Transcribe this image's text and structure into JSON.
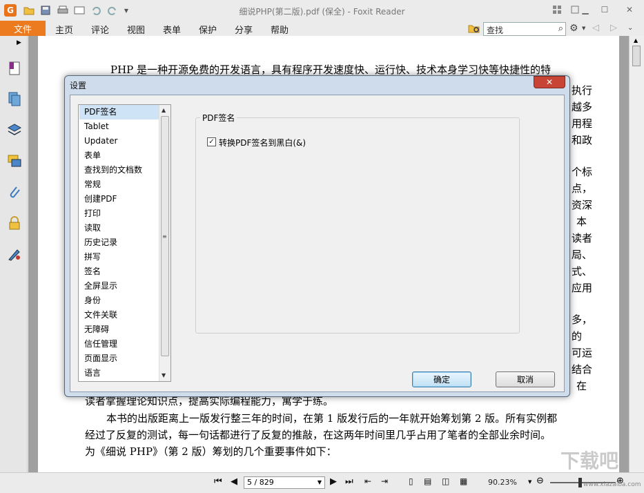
{
  "window": {
    "title": "细说PHP(第二版).pdf (保全) - Foxit Reader",
    "app_icon": "G"
  },
  "menu": {
    "file": "文件",
    "items": [
      "主页",
      "评论",
      "视图",
      "表单",
      "保护",
      "分享",
      "帮助"
    ]
  },
  "search": {
    "value": "查找"
  },
  "document": {
    "lines": [
      "PHP 是一种开源免费的开发语言，具有程序开发速度快、运行快、技术本身学习快等快捷性的特",
      "读者掌握理论知识点，提高实际编程能力，寓学于练。",
      "本书的出版距离上一版发行整三年的时间，在第 1 版发行后的一年就开始筹划第 2 版。所有实例都",
      "经过了反复的测试，每一句话都进行了反复的推敲，在这两年时间里几乎占用了笔者的全部业余时间。",
      "为《细说 PHP》（第 2 版）筹划的几个重要事件如下："
    ],
    "right_edge": [
      "执行",
      "越多",
      "用程",
      "和政",
      "个标",
      "点，",
      "资深",
      "本",
      "读者",
      "局、",
      "式、",
      "应用",
      "多，",
      "的",
      "可运",
      "结合",
      "在"
    ]
  },
  "status": {
    "page": "5 / 829",
    "zoom": "90.23%"
  },
  "dialog": {
    "title": "设置",
    "nav_items": [
      "PDF签名",
      "Tablet",
      "Updater",
      "表单",
      "查找到的文档数",
      "常规",
      "创建PDF",
      "打印",
      "读取",
      "历史记录",
      "拼写",
      "签名",
      "全屏显示",
      "身份",
      "文件关联",
      "无障碍",
      "信任管理",
      "页面显示",
      "语言"
    ],
    "selected_index": 0,
    "group_label": "PDF签名",
    "checkbox_label": "转换PDF签名到黑白(&)",
    "checkbox_checked": true,
    "ok_label": "确定",
    "cancel_label": "取消"
  },
  "watermark": {
    "text": "下载吧",
    "sub": "www.xiazaiba.com"
  }
}
